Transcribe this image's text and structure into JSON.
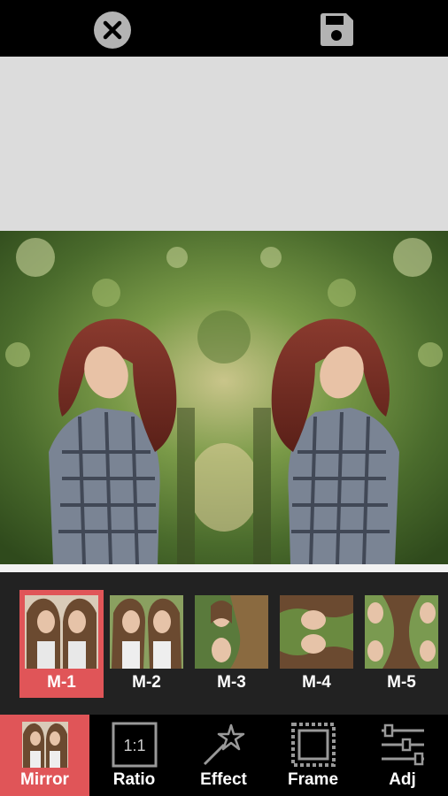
{
  "toolbar_top": {
    "close_icon": "close-icon",
    "save_icon": "save-icon"
  },
  "mirror_presets": {
    "selected": "M-1",
    "items": [
      {
        "label": "M-1"
      },
      {
        "label": "M-2"
      },
      {
        "label": "M-3"
      },
      {
        "label": "M-4"
      },
      {
        "label": "M-5"
      }
    ]
  },
  "tools": {
    "active": "Mirror",
    "items": [
      {
        "label": "Mirror",
        "icon": "mirror-thumbnail-icon"
      },
      {
        "label": "Ratio",
        "icon": "ratio-icon",
        "icon_text": "1:1"
      },
      {
        "label": "Effect",
        "icon": "magic-wand-icon"
      },
      {
        "label": "Frame",
        "icon": "frame-icon"
      },
      {
        "label": "Adj",
        "icon": "sliders-icon"
      }
    ]
  },
  "colors": {
    "accent": "#e05558",
    "panel_bg": "#222222",
    "canvas_bg": "#dcdcdc"
  }
}
